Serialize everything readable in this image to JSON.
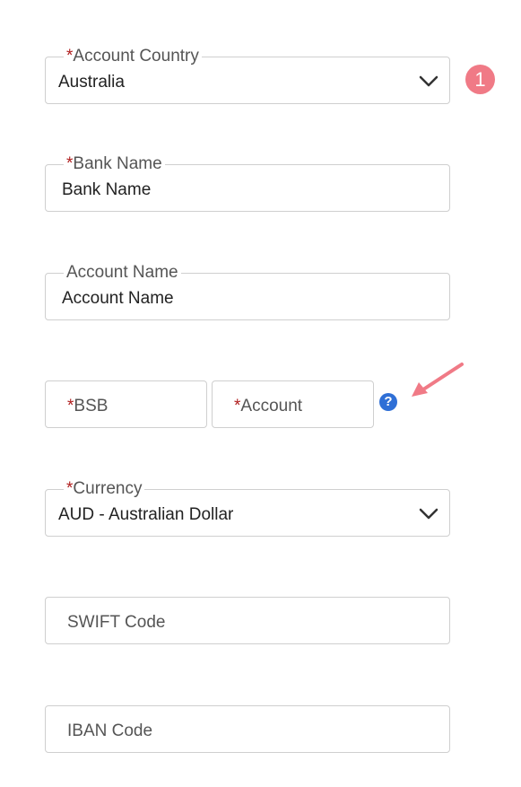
{
  "form": {
    "account_country": {
      "label": "Account Country",
      "value": "Australia",
      "required_mark": "*"
    },
    "bank_name": {
      "label": "Bank Name",
      "value": "Bank Name",
      "required_mark": "*"
    },
    "account_name": {
      "label": "Account Name",
      "value": "Account Name"
    },
    "bsb": {
      "placeholder": "BSB",
      "required_mark": "*"
    },
    "account": {
      "placeholder": "Account",
      "required_mark": "*"
    },
    "currency": {
      "label": "Currency",
      "value": "AUD - Australian Dollar",
      "required_mark": "*"
    },
    "swift": {
      "placeholder": "SWIFT Code"
    },
    "iban": {
      "placeholder": "IBAN Code"
    }
  },
  "annotations": {
    "step_badge": "1",
    "help_icon": "?",
    "icons": [
      "chevron-down-icon",
      "help-circle-icon",
      "pointer-arrow-icon"
    ],
    "colors": {
      "required": "#b01e1e",
      "badge": "#f07a86",
      "help": "#2f6fd6",
      "arrow": "#f07a86"
    }
  }
}
